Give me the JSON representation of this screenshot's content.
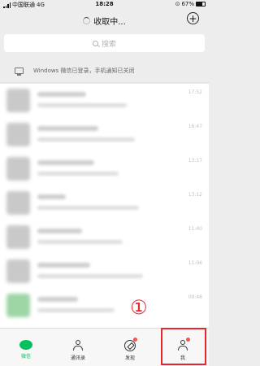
{
  "status_bar": {
    "carrier": "中国联通",
    "network": "4G",
    "time": "18:28",
    "battery": "67%",
    "battery_level": 0.67
  },
  "nav": {
    "title": "收取中...",
    "add_symbol": "+"
  },
  "search": {
    "placeholder": "搜索"
  },
  "notice": {
    "text": "Windows 微信已登录，手机通知已关闭"
  },
  "chats": [
    {
      "time": "17:52"
    },
    {
      "time": "16:47"
    },
    {
      "time": "13:17"
    },
    {
      "time": "13:12"
    },
    {
      "time": "11:40"
    },
    {
      "time": "11:06"
    },
    {
      "time": "09:48"
    }
  ],
  "tabbar": {
    "tabs": [
      {
        "label": "微信"
      },
      {
        "label": "通讯录"
      },
      {
        "label": "发现"
      },
      {
        "label": "我"
      }
    ]
  },
  "annotation": {
    "marker": "①"
  },
  "colors": {
    "accent": "#07c160",
    "badge": "#fa5151",
    "annotation": "#e8262c"
  }
}
